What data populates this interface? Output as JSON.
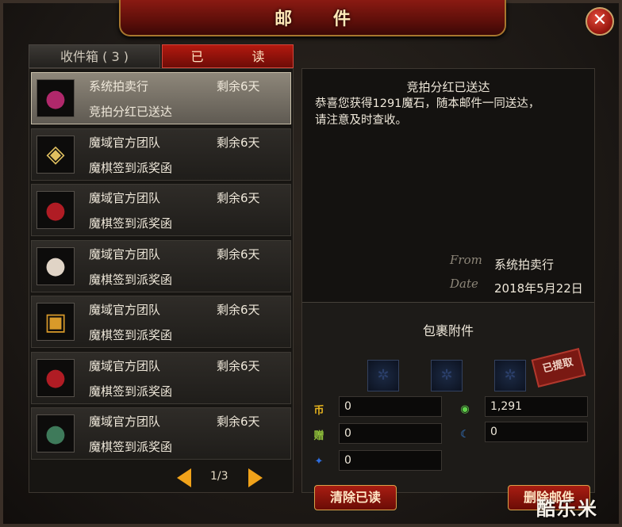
{
  "window": {
    "title": "邮 件",
    "close_label": "✕"
  },
  "tabs": [
    {
      "label": "收件箱 ( 3 )",
      "active": false
    },
    {
      "label": "已 读",
      "active": true
    }
  ],
  "mail_list": [
    {
      "sender": "系统拍卖行",
      "days_left": "剩余6天",
      "subject": "竞拍分红已送达",
      "icon": "purple-bag-icon",
      "selected": true
    },
    {
      "sender": "魔域官方团队",
      "days_left": "剩余6天",
      "subject": "魔棋签到派奖函",
      "icon": "gold-coin-icon"
    },
    {
      "sender": "魔域官方团队",
      "days_left": "剩余6天",
      "subject": "魔棋签到派奖函",
      "icon": "red-bag-icon"
    },
    {
      "sender": "魔域官方团队",
      "days_left": "剩余6天",
      "subject": "魔棋签到派奖函",
      "icon": "white-bag-icon"
    },
    {
      "sender": "魔域官方团队",
      "days_left": "剩余6天",
      "subject": "魔棋签到派奖函",
      "icon": "treasure-chest-icon"
    },
    {
      "sender": "魔域官方团队",
      "days_left": "剩余6天",
      "subject": "魔棋签到派奖函",
      "icon": "red-bag-icon"
    },
    {
      "sender": "魔域官方团队",
      "days_left": "剩余6天",
      "subject": "魔棋签到派奖函",
      "icon": "gem-pouch-icon"
    }
  ],
  "pager": {
    "label": "1/3"
  },
  "mail": {
    "title": "竞拍分红已送达",
    "body": "恭喜您获得1291魔石，随本邮件一同送达，\n请注意及时查收。",
    "from_label": "From",
    "from_value": "系统拍卖行",
    "date_label": "Date",
    "date_value": "2018年5月22日"
  },
  "attachments": {
    "title": "包裹附件",
    "stamp": "已提取",
    "currencies": [
      {
        "icon": "gold-coin-icon",
        "glyph": "币",
        "color": "#e6b31e",
        "value": "0"
      },
      {
        "icon": "green-magic-stone-icon",
        "glyph": "◉",
        "color": "#5fd14a",
        "value": "1,291"
      },
      {
        "icon": "bonus-coupon-icon",
        "glyph": "赠",
        "color": "#8fbf3a",
        "value": "0"
      },
      {
        "icon": "blue-moon-icon",
        "glyph": "☾",
        "color": "#3a8cf0",
        "value": "0"
      },
      {
        "icon": "blue-crystal-icon",
        "glyph": "✦",
        "color": "#2e6ee0",
        "value": "0"
      }
    ]
  },
  "buttons": {
    "clear_read": "清除已读",
    "delete_mail": "删除邮件"
  },
  "watermark": "酷乐米"
}
